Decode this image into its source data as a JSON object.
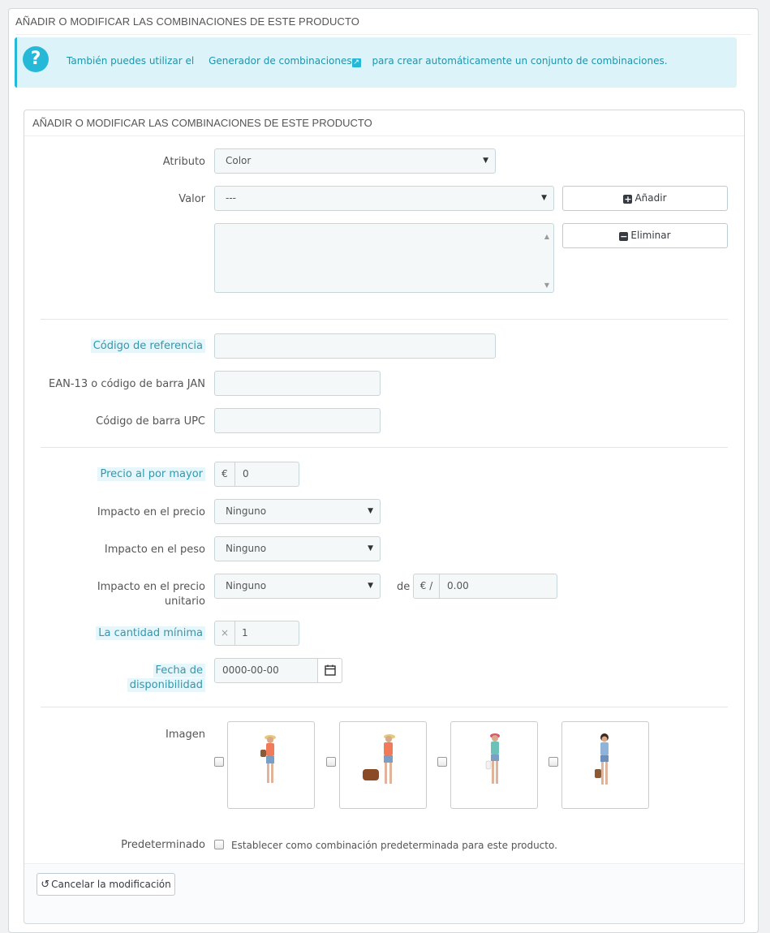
{
  "outer_panel": {
    "title": "AÑADIR O MODIFICAR LAS COMBINACIONES DE ESTE PRODUCTO"
  },
  "info_box": {
    "icon": "question-icon",
    "text_before": "También puedes utilizar el",
    "link_text": "Generador de combinaciones",
    "text_after": "para crear automáticamente un conjunto de combinaciones."
  },
  "inner_panel": {
    "title": "AÑADIR O MODIFICAR LAS COMBINACIONES DE ESTE PRODUCTO"
  },
  "form": {
    "attribute": {
      "label": "Atributo",
      "value": "Color"
    },
    "value": {
      "label": "Valor",
      "value": "---"
    },
    "add_button": "Añadir",
    "delete_button": "Eliminar",
    "reference": {
      "label": "Código de referencia",
      "value": ""
    },
    "ean13": {
      "label": "EAN-13 o código de barra JAN",
      "value": ""
    },
    "upc": {
      "label": "Código de barra UPC",
      "value": ""
    },
    "wholesale_price": {
      "label": "Precio al por mayor",
      "currency": "€",
      "value": "0"
    },
    "price_impact": {
      "label": "Impacto en el precio",
      "value": "Ninguno"
    },
    "weight_impact": {
      "label": "Impacto en el peso",
      "value": "Ninguno"
    },
    "unit_price_impact": {
      "label_line1": "Impacto en el precio",
      "label_line2": "unitario",
      "value": "Ninguno",
      "de": "de",
      "currency": "€ /",
      "amount": "0.00"
    },
    "min_quantity": {
      "label": "La cantidad mínima",
      "prefix": "×",
      "value": "1"
    },
    "availability_date": {
      "label_line1": "Fecha de",
      "label_line2": "disponibilidad",
      "value": "0000-00-00"
    },
    "image": {
      "label": "Imagen"
    },
    "default": {
      "label": "Predeterminado",
      "checkbox_text": "Establecer como combinación predeterminada para este producto."
    },
    "cancel_button": "Cancelar la modificación"
  },
  "colors": {
    "accent": "#25b9d7",
    "info_bg": "#dcf4f9",
    "highlight_text": "#2e99b0"
  }
}
